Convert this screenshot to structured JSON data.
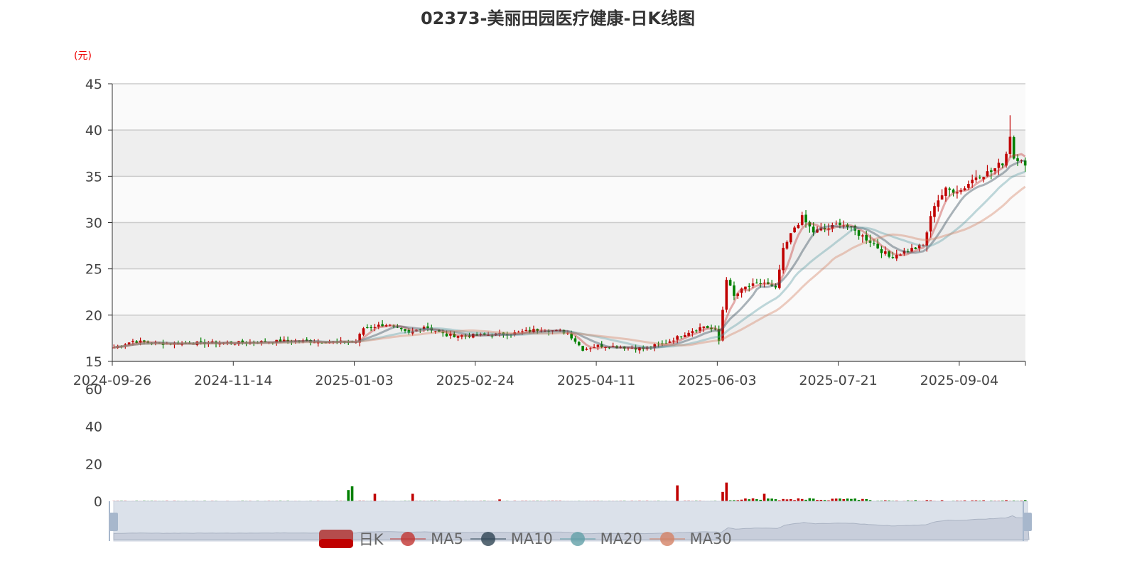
{
  "chart_data": {
    "type": "candlestick",
    "title": "02373-美丽田园医疗健康-日K线图",
    "ylabel": "(元)",
    "ylim": [
      15,
      45
    ],
    "yticks": [
      15,
      20,
      25,
      30,
      35,
      40,
      45
    ],
    "volume_ylim": [
      0,
      60
    ],
    "volume_yticks": [
      0,
      20,
      40,
      60
    ],
    "xticks": [
      "2024-09-26",
      "2024-11-14",
      "2025-01-03",
      "2025-02-24",
      "2025-04-11",
      "2025-06-03",
      "2025-07-21",
      "2025-09-04"
    ],
    "xtick_index": [
      0,
      32,
      64,
      96,
      128,
      160,
      192,
      224
    ],
    "n_days": 242,
    "close_keypoints": [
      [
        0,
        16.5
      ],
      [
        5,
        17.2
      ],
      [
        12,
        16.9
      ],
      [
        20,
        17.0
      ],
      [
        32,
        17.0
      ],
      [
        45,
        17.2
      ],
      [
        60,
        17.1
      ],
      [
        64,
        17.1
      ],
      [
        66,
        18.6
      ],
      [
        72,
        19.0
      ],
      [
        78,
        18.0
      ],
      [
        82,
        18.8
      ],
      [
        88,
        17.8
      ],
      [
        96,
        17.8
      ],
      [
        105,
        18.0
      ],
      [
        113,
        18.5
      ],
      [
        120,
        18.1
      ],
      [
        124,
        16.3
      ],
      [
        128,
        16.7
      ],
      [
        140,
        16.4
      ],
      [
        146,
        17.0
      ],
      [
        152,
        18.2
      ],
      [
        156,
        18.8
      ],
      [
        159,
        18.3
      ],
      [
        160,
        17.2
      ],
      [
        162,
        24.0
      ],
      [
        164,
        22.0
      ],
      [
        167,
        23.0
      ],
      [
        172,
        23.5
      ],
      [
        175,
        22.8
      ],
      [
        177,
        27.0
      ],
      [
        180,
        29.5
      ],
      [
        182,
        30.5
      ],
      [
        185,
        29.0
      ],
      [
        190,
        29.5
      ],
      [
        192,
        30.0
      ],
      [
        195,
        29.3
      ],
      [
        200,
        28.0
      ],
      [
        205,
        26.3
      ],
      [
        210,
        27.0
      ],
      [
        214,
        27.5
      ],
      [
        217,
        32.0
      ],
      [
        220,
        33.5
      ],
      [
        224,
        33.5
      ],
      [
        228,
        35.0
      ],
      [
        232,
        35.5
      ],
      [
        235,
        36.5
      ],
      [
        236,
        37.5
      ],
      [
        237,
        39.5
      ],
      [
        238,
        37.0
      ],
      [
        240,
        37.0
      ],
      [
        241,
        36.0
      ]
    ],
    "volume_spikes": [
      [
        62,
        6
      ],
      [
        63,
        8
      ],
      [
        69,
        4
      ],
      [
        79,
        4
      ],
      [
        102,
        1
      ],
      [
        149,
        8.5
      ],
      [
        161,
        5
      ],
      [
        162,
        10
      ],
      [
        172,
        4
      ],
      [
        178,
        1
      ]
    ],
    "legend": [
      "日K",
      "MA5",
      "MA10",
      "MA20",
      "MA30"
    ],
    "colors": {
      "up": "#c00000",
      "down": "#008000",
      "ma5": "#c23531",
      "ma10": "#2f4554",
      "ma20": "#61a0a8",
      "ma30": "#d48265"
    }
  }
}
